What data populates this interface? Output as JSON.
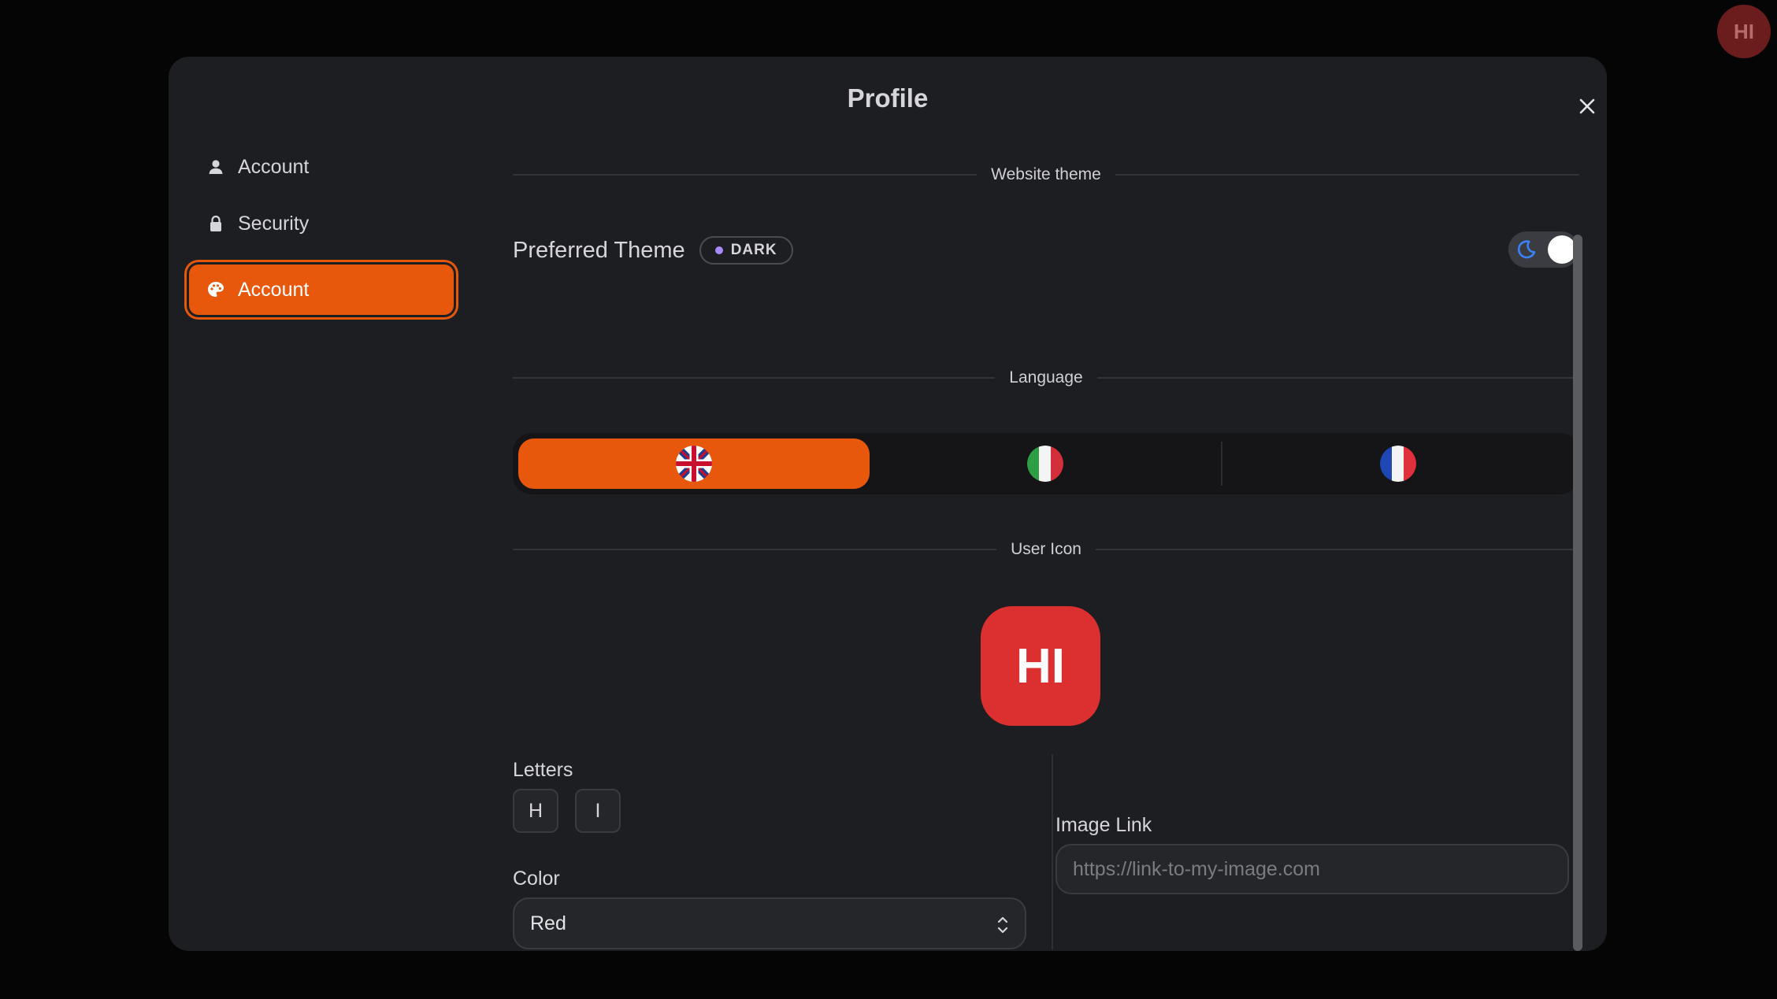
{
  "header": {
    "avatar_initials": "HI"
  },
  "modal": {
    "title": "Profile",
    "close_icon": "close-icon"
  },
  "sidebar": {
    "items": [
      {
        "label": "Account",
        "icon": "user-icon",
        "active": false
      },
      {
        "label": "Security",
        "icon": "lock-icon",
        "active": false
      },
      {
        "label": "Account",
        "icon": "palette-icon",
        "active": true
      }
    ]
  },
  "theme_section": {
    "heading": "Website theme",
    "label": "Preferred Theme",
    "badge": "DARK",
    "toggle_icon": "moon-icon",
    "toggle_on": true
  },
  "language_section": {
    "heading": "Language",
    "options": [
      {
        "flag": "uk-flag-icon",
        "active": true
      },
      {
        "flag": "italy-flag-icon",
        "active": false
      },
      {
        "flag": "france-flag-icon",
        "active": false
      }
    ]
  },
  "user_icon_section": {
    "heading": "User Icon",
    "preview_text": "HI",
    "color_hex": "#dc2f2f",
    "letters_label": "Letters",
    "letters": [
      "H",
      "I"
    ],
    "color_label": "Color",
    "color_value": "Red",
    "image_link_label": "Image Link",
    "image_link_placeholder": "https://link-to-my-image.com",
    "image_link_value": ""
  },
  "colors": {
    "accent": "#e8580c",
    "background": "#050505",
    "modal_bg": "#1d1e22"
  }
}
